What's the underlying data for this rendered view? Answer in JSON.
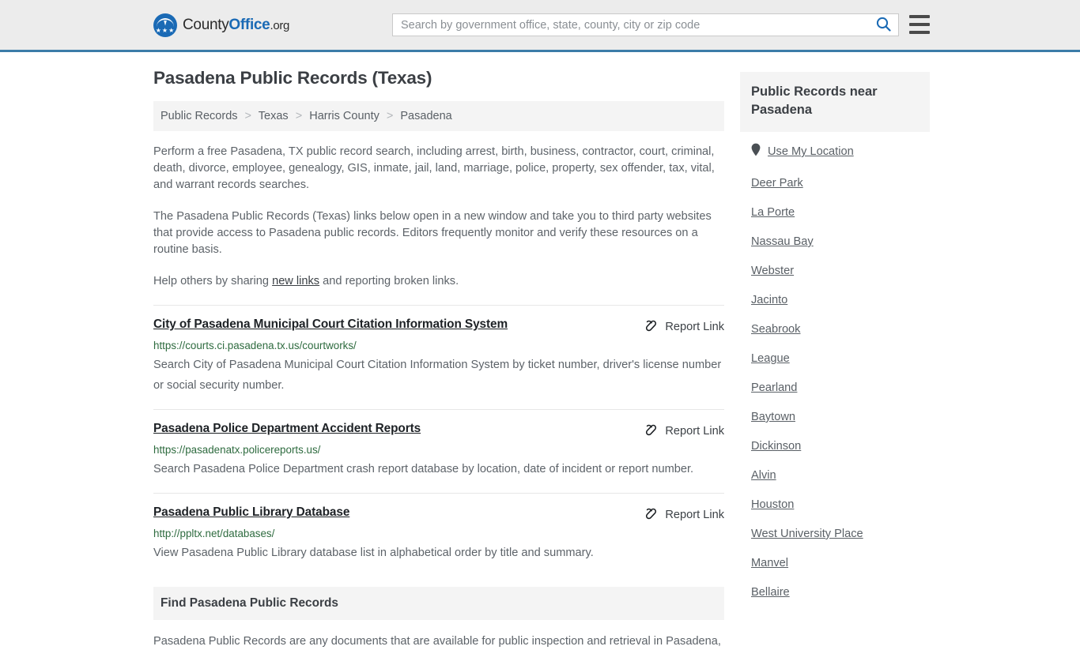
{
  "header": {
    "logo": {
      "part1": "County",
      "part2": "Office",
      "part3": ".org",
      "icon": "eagle-shield-logo"
    },
    "search": {
      "placeholder": "Search by government office, state, county, city or zip code",
      "value": "",
      "search_icon": "search-icon"
    },
    "menu_icon": "hamburger-menu-icon",
    "accent_color": "#3b7ca8"
  },
  "main": {
    "title": "Pasadena Public Records (Texas)",
    "breadcrumb": [
      {
        "label": "Public Records",
        "current": false
      },
      {
        "label": "Texas",
        "current": false
      },
      {
        "label": "Harris County",
        "current": false
      },
      {
        "label": "Pasadena",
        "current": true
      }
    ],
    "breadcrumb_separator": ">",
    "intro_1": "Perform a free Pasadena, TX public record search, including arrest, birth, business, contractor, court, criminal, death, divorce, employee, genealogy, GIS, inmate, jail, land, marriage, police, property, sex offender, tax, vital, and warrant records searches.",
    "intro_2": "The Pasadena Public Records (Texas) links below open in a new window and take you to third party websites that provide access to Pasadena public records. Editors frequently monitor and verify these resources on a routine basis.",
    "intro_3_before": "Help others by sharing ",
    "intro_3_link": "new links",
    "intro_3_after": " and reporting broken links.",
    "report_link_label": "Report Link",
    "report_link_icon": "broken-link-icon",
    "results": [
      {
        "title": "City of Pasadena Municipal Court Citation Information System",
        "url": "https://courts.ci.pasadena.tx.us/courtworks/",
        "description": "Search City of Pasadena Municipal Court Citation Information System by ticket number, driver's license number or social security number."
      },
      {
        "title": "Pasadena Police Department Accident Reports",
        "url": "https://pasadenatx.policereports.us/",
        "description": "Search Pasadena Police Department crash report database by location, date of incident or report number."
      },
      {
        "title": "Pasadena Public Library Database",
        "url": "http://ppltx.net/databases/",
        "description": "View Pasadena Public Library database list in alphabetical order by title and summary."
      }
    ],
    "section": {
      "heading": "Find Pasadena Public Records",
      "body": "Pasadena Public Records are any documents that are available for public inspection and retrieval in Pasadena,"
    },
    "url_color": "#2e6b3f"
  },
  "sidebar": {
    "heading": "Public Records near Pasadena",
    "use_my_location": {
      "label": "Use My Location",
      "icon": "map-pin-icon"
    },
    "items": [
      {
        "label": "Deer Park"
      },
      {
        "label": "La Porte"
      },
      {
        "label": "Nassau Bay"
      },
      {
        "label": "Webster"
      },
      {
        "label": "Jacinto"
      },
      {
        "label": "Seabrook"
      },
      {
        "label": "League"
      },
      {
        "label": "Pearland"
      },
      {
        "label": "Baytown"
      },
      {
        "label": "Dickinson"
      },
      {
        "label": "Alvin"
      },
      {
        "label": "Houston"
      },
      {
        "label": "West University Place"
      },
      {
        "label": "Manvel"
      },
      {
        "label": "Bellaire"
      }
    ]
  }
}
